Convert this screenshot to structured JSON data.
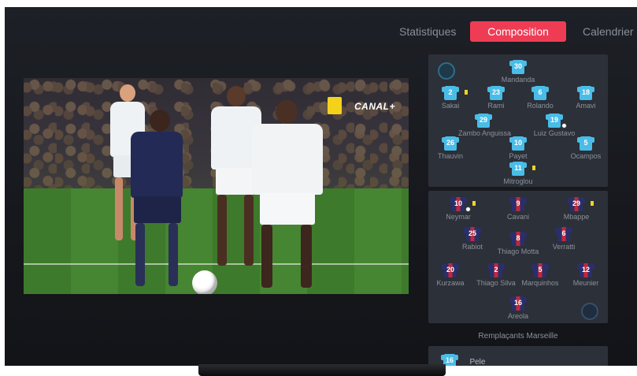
{
  "tabs": [
    {
      "label": "Statistiques"
    },
    {
      "label": "Composition"
    },
    {
      "label": "Calendrier"
    }
  ],
  "video": {
    "broadcaster_logo": "CANAL+"
  },
  "colors": {
    "accent": "#ef3c55",
    "om_jersey": "#49bde8",
    "psg_blue": "#2a2f6b",
    "psg_red": "#c0283b",
    "card_yellow": "#f3d323"
  },
  "marseille": {
    "crest_icon": "olympique-marseille-crest-icon",
    "players": [
      {
        "number": "30",
        "name": "Mandanda"
      },
      {
        "number": "2",
        "name": "Sakai",
        "card": true
      },
      {
        "number": "23",
        "name": "Rami"
      },
      {
        "number": "6",
        "name": "Rolando"
      },
      {
        "number": "18",
        "name": "Amavi"
      },
      {
        "number": "29",
        "name": "Zambo Anguissa"
      },
      {
        "number": "19",
        "name": "Luiz Gustavo",
        "goal": true
      },
      {
        "number": "26",
        "name": "Thauvin"
      },
      {
        "number": "10",
        "name": "Payet"
      },
      {
        "number": "5",
        "name": "Ocampos"
      },
      {
        "number": "11",
        "name": "Mitroglou",
        "card": true
      }
    ]
  },
  "psg": {
    "crest_icon": "paris-saint-germain-crest-icon",
    "players": [
      {
        "number": "10",
        "name": "Neymar",
        "card": true,
        "goal": true
      },
      {
        "number": "9",
        "name": "Cavani"
      },
      {
        "number": "29",
        "name": "Mbappe",
        "card": true
      },
      {
        "number": "25",
        "name": "Rabiot"
      },
      {
        "number": "8",
        "name": "Thiago Motta"
      },
      {
        "number": "6",
        "name": "Verratti"
      },
      {
        "number": "20",
        "name": "Kurzawa"
      },
      {
        "number": "2",
        "name": "Thiago Silva"
      },
      {
        "number": "5",
        "name": "Marquinhos"
      },
      {
        "number": "12",
        "name": "Meunier"
      },
      {
        "number": "16",
        "name": "Areola"
      }
    ]
  },
  "substitutes": {
    "title": "Remplaçants Marseille",
    "players": [
      {
        "number": "16",
        "name": "Pele"
      }
    ]
  }
}
